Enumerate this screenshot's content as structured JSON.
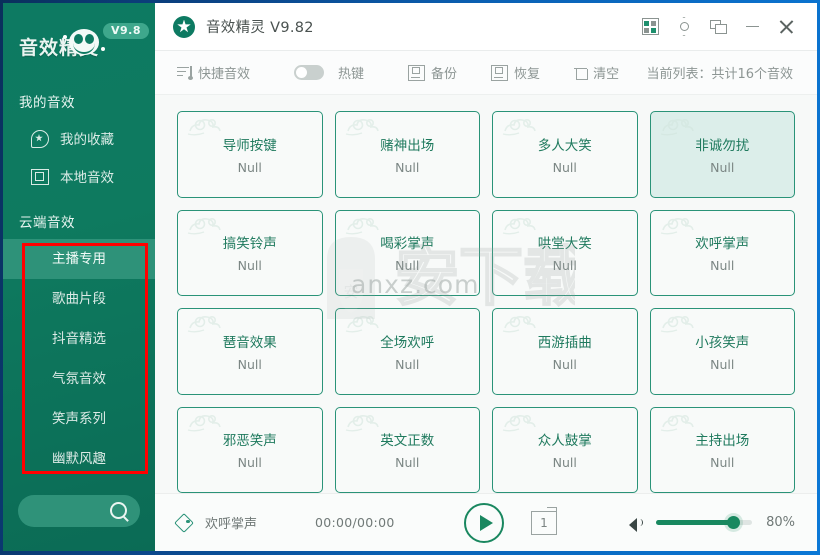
{
  "window": {
    "title": "音效精灵 V9.82",
    "buttons": [
      {
        "name": "skin-icon",
        "label": "皮肤"
      },
      {
        "name": "settings-icon",
        "label": "设置"
      },
      {
        "name": "tray-icon",
        "label": "最小化到托盘"
      },
      {
        "name": "minimize-icon",
        "label": "最小化"
      },
      {
        "name": "close-icon",
        "label": "关闭"
      }
    ]
  },
  "sidebar": {
    "logo_text": "音效精灵",
    "version_badge": "V9.8",
    "my_sound_header": "我的音效",
    "my_items": [
      {
        "label": "我的收藏",
        "icon": "star-icon"
      },
      {
        "label": "本地音效",
        "icon": "box-icon"
      }
    ],
    "cloud_header": "云端音效",
    "categories": [
      {
        "label": "主播专用",
        "active": true
      },
      {
        "label": "歌曲片段",
        "active": false
      },
      {
        "label": "抖音精选",
        "active": false
      },
      {
        "label": "气氛音效",
        "active": false
      },
      {
        "label": "笑声系列",
        "active": false
      },
      {
        "label": "幽默风趣",
        "active": false
      }
    ],
    "search_placeholder": ""
  },
  "toolbar": {
    "quick_label": "快捷音效",
    "hotkey_label": "热键",
    "hotkey_on": false,
    "backup_label": "备份",
    "restore_label": "恢复",
    "clear_label": "清空",
    "count_label": "当前列表：共计16个音效"
  },
  "grid": {
    "sub_text": "Null",
    "cards": [
      {
        "name": "导师按键",
        "sub": "Null",
        "selected": false
      },
      {
        "name": "赌神出场",
        "sub": "Null",
        "selected": false
      },
      {
        "name": "多人大笑",
        "sub": "Null",
        "selected": false
      },
      {
        "name": "非诚勿扰",
        "sub": "Null",
        "selected": true
      },
      {
        "name": "搞笑铃声",
        "sub": "Null",
        "selected": false
      },
      {
        "name": "喝彩掌声",
        "sub": "Null",
        "selected": false
      },
      {
        "name": "哄堂大笑",
        "sub": "Null",
        "selected": false
      },
      {
        "name": "欢呼掌声",
        "sub": "Null",
        "selected": false
      },
      {
        "name": "琶音效果",
        "sub": "Null",
        "selected": false
      },
      {
        "name": "全场欢呼",
        "sub": "Null",
        "selected": false
      },
      {
        "name": "西游插曲",
        "sub": "Null",
        "selected": false
      },
      {
        "name": "小孩笑声",
        "sub": "Null",
        "selected": false
      },
      {
        "name": "邪恶笑声",
        "sub": "Null",
        "selected": false
      },
      {
        "name": "英文正数",
        "sub": "Null",
        "selected": false
      },
      {
        "name": "众人鼓掌",
        "sub": "Null",
        "selected": false
      },
      {
        "name": "主持出场",
        "sub": "Null",
        "selected": false
      }
    ]
  },
  "watermark": {
    "text_cn": "安下载",
    "text_url": "anxz.com"
  },
  "player": {
    "track_name": "欢呼掌声",
    "time": "00:00/00:00",
    "play_state": "paused",
    "mode_label": "1",
    "volume_percent": "80%",
    "volume_value": 80
  },
  "colors": {
    "brand_green": "#0d7a62",
    "accent_green": "#2a9378",
    "selected_card": "#dceeea",
    "annotation_red": "#ff0000",
    "desktop_blue": "#0b78d6"
  }
}
